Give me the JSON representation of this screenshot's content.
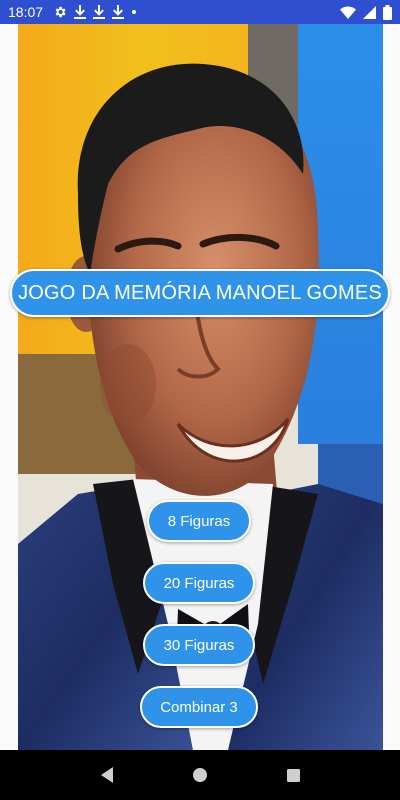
{
  "status_bar": {
    "time": "18:07",
    "left_icons": [
      "gear-icon",
      "download-icon",
      "download-icon",
      "download-icon",
      "dot-icon"
    ],
    "right_icons": [
      "wifi-icon",
      "signal-icon",
      "battery-icon"
    ]
  },
  "main": {
    "title": "JOGO DA MEMÓRIA MANOEL GOMES",
    "options": [
      {
        "label": "8 Figuras"
      },
      {
        "label": "20 Figuras"
      },
      {
        "label": "30 Figuras"
      },
      {
        "label": "Combinar 3"
      }
    ]
  },
  "nav_bar": {
    "buttons": [
      "back-icon",
      "home-icon",
      "recents-icon"
    ]
  },
  "colors": {
    "status_bar": "#2e4fd0",
    "button": "#2f93e9",
    "button_border": "#ffffff",
    "nav_bar": "#000000"
  }
}
